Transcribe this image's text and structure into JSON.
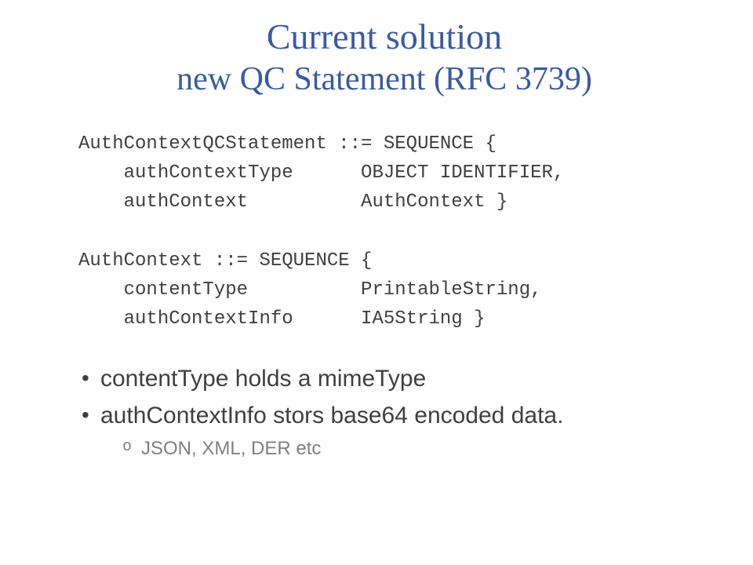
{
  "title": "Current solution",
  "subtitle": "new QC Statement (RFC 3739)",
  "code": "AuthContextQCStatement ::= SEQUENCE {\n    authContextType      OBJECT IDENTIFIER,\n    authContext          AuthContext }\n\nAuthContext ::= SEQUENCE {\n    contentType          PrintableString,\n    authContextInfo      IA5String }",
  "bullets": [
    {
      "text": "contentType holds a mimeType"
    },
    {
      "text": "authContextInfo stors base64 encoded data.",
      "sub": [
        "JSON, XML, DER etc"
      ]
    }
  ]
}
